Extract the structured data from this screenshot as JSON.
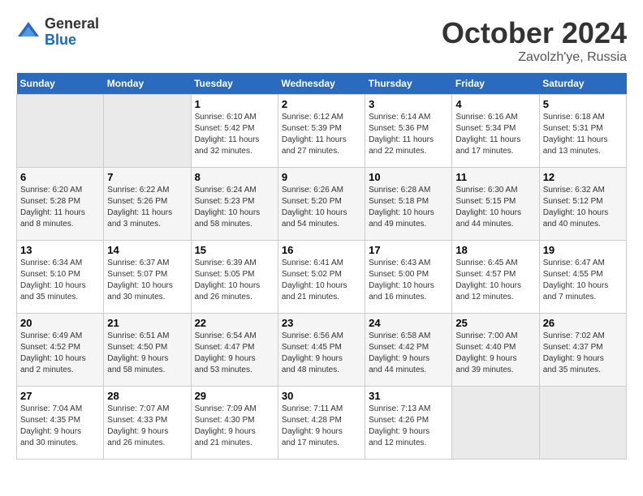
{
  "header": {
    "logo_general": "General",
    "logo_blue": "Blue",
    "month": "October 2024",
    "location": "Zavolzh'ye, Russia"
  },
  "days_of_week": [
    "Sunday",
    "Monday",
    "Tuesday",
    "Wednesday",
    "Thursday",
    "Friday",
    "Saturday"
  ],
  "weeks": [
    [
      {
        "day": "",
        "info": ""
      },
      {
        "day": "",
        "info": ""
      },
      {
        "day": "1",
        "info": "Sunrise: 6:10 AM\nSunset: 5:42 PM\nDaylight: 11 hours\nand 32 minutes."
      },
      {
        "day": "2",
        "info": "Sunrise: 6:12 AM\nSunset: 5:39 PM\nDaylight: 11 hours\nand 27 minutes."
      },
      {
        "day": "3",
        "info": "Sunrise: 6:14 AM\nSunset: 5:36 PM\nDaylight: 11 hours\nand 22 minutes."
      },
      {
        "day": "4",
        "info": "Sunrise: 6:16 AM\nSunset: 5:34 PM\nDaylight: 11 hours\nand 17 minutes."
      },
      {
        "day": "5",
        "info": "Sunrise: 6:18 AM\nSunset: 5:31 PM\nDaylight: 11 hours\nand 13 minutes."
      }
    ],
    [
      {
        "day": "6",
        "info": "Sunrise: 6:20 AM\nSunset: 5:28 PM\nDaylight: 11 hours\nand 8 minutes."
      },
      {
        "day": "7",
        "info": "Sunrise: 6:22 AM\nSunset: 5:26 PM\nDaylight: 11 hours\nand 3 minutes."
      },
      {
        "day": "8",
        "info": "Sunrise: 6:24 AM\nSunset: 5:23 PM\nDaylight: 10 hours\nand 58 minutes."
      },
      {
        "day": "9",
        "info": "Sunrise: 6:26 AM\nSunset: 5:20 PM\nDaylight: 10 hours\nand 54 minutes."
      },
      {
        "day": "10",
        "info": "Sunrise: 6:28 AM\nSunset: 5:18 PM\nDaylight: 10 hours\nand 49 minutes."
      },
      {
        "day": "11",
        "info": "Sunrise: 6:30 AM\nSunset: 5:15 PM\nDaylight: 10 hours\nand 44 minutes."
      },
      {
        "day": "12",
        "info": "Sunrise: 6:32 AM\nSunset: 5:12 PM\nDaylight: 10 hours\nand 40 minutes."
      }
    ],
    [
      {
        "day": "13",
        "info": "Sunrise: 6:34 AM\nSunset: 5:10 PM\nDaylight: 10 hours\nand 35 minutes."
      },
      {
        "day": "14",
        "info": "Sunrise: 6:37 AM\nSunset: 5:07 PM\nDaylight: 10 hours\nand 30 minutes."
      },
      {
        "day": "15",
        "info": "Sunrise: 6:39 AM\nSunset: 5:05 PM\nDaylight: 10 hours\nand 26 minutes."
      },
      {
        "day": "16",
        "info": "Sunrise: 6:41 AM\nSunset: 5:02 PM\nDaylight: 10 hours\nand 21 minutes."
      },
      {
        "day": "17",
        "info": "Sunrise: 6:43 AM\nSunset: 5:00 PM\nDaylight: 10 hours\nand 16 minutes."
      },
      {
        "day": "18",
        "info": "Sunrise: 6:45 AM\nSunset: 4:57 PM\nDaylight: 10 hours\nand 12 minutes."
      },
      {
        "day": "19",
        "info": "Sunrise: 6:47 AM\nSunset: 4:55 PM\nDaylight: 10 hours\nand 7 minutes."
      }
    ],
    [
      {
        "day": "20",
        "info": "Sunrise: 6:49 AM\nSunset: 4:52 PM\nDaylight: 10 hours\nand 2 minutes."
      },
      {
        "day": "21",
        "info": "Sunrise: 6:51 AM\nSunset: 4:50 PM\nDaylight: 9 hours\nand 58 minutes."
      },
      {
        "day": "22",
        "info": "Sunrise: 6:54 AM\nSunset: 4:47 PM\nDaylight: 9 hours\nand 53 minutes."
      },
      {
        "day": "23",
        "info": "Sunrise: 6:56 AM\nSunset: 4:45 PM\nDaylight: 9 hours\nand 48 minutes."
      },
      {
        "day": "24",
        "info": "Sunrise: 6:58 AM\nSunset: 4:42 PM\nDaylight: 9 hours\nand 44 minutes."
      },
      {
        "day": "25",
        "info": "Sunrise: 7:00 AM\nSunset: 4:40 PM\nDaylight: 9 hours\nand 39 minutes."
      },
      {
        "day": "26",
        "info": "Sunrise: 7:02 AM\nSunset: 4:37 PM\nDaylight: 9 hours\nand 35 minutes."
      }
    ],
    [
      {
        "day": "27",
        "info": "Sunrise: 7:04 AM\nSunset: 4:35 PM\nDaylight: 9 hours\nand 30 minutes."
      },
      {
        "day": "28",
        "info": "Sunrise: 7:07 AM\nSunset: 4:33 PM\nDaylight: 9 hours\nand 26 minutes."
      },
      {
        "day": "29",
        "info": "Sunrise: 7:09 AM\nSunset: 4:30 PM\nDaylight: 9 hours\nand 21 minutes."
      },
      {
        "day": "30",
        "info": "Sunrise: 7:11 AM\nSunset: 4:28 PM\nDaylight: 9 hours\nand 17 minutes."
      },
      {
        "day": "31",
        "info": "Sunrise: 7:13 AM\nSunset: 4:26 PM\nDaylight: 9 hours\nand 12 minutes."
      },
      {
        "day": "",
        "info": ""
      },
      {
        "day": "",
        "info": ""
      }
    ]
  ]
}
